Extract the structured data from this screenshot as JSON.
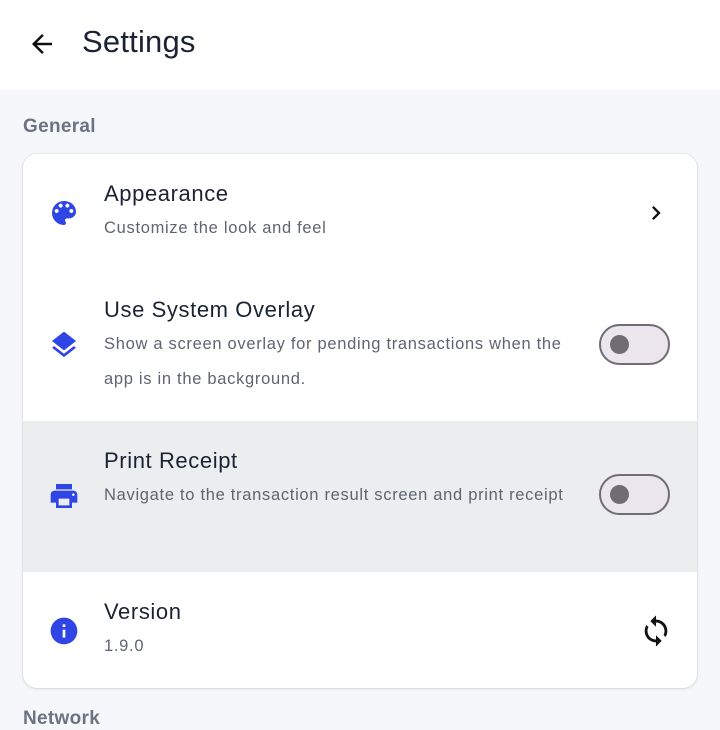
{
  "header": {
    "title": "Settings",
    "back_icon": "arrow-back-icon"
  },
  "sections": [
    {
      "title": "General",
      "items": [
        {
          "title": "Appearance",
          "subtitle": "Customize the look and feel",
          "icon": "palette-icon",
          "trailing": "chevron-right-icon"
        },
        {
          "title": "Use System Overlay",
          "subtitle": "Show a screen overlay for pending transactions when the app is in the background.",
          "icon": "layers-icon",
          "toggle_on": false
        },
        {
          "title": "Print Receipt",
          "subtitle": "Navigate to the transaction result screen and print receipt",
          "icon": "printer-icon",
          "toggle_on": false
        },
        {
          "title": "Version",
          "subtitle": "1.9.0",
          "icon": "info-icon",
          "trailing": "sync-icon"
        }
      ]
    }
  ],
  "next_section": {
    "title": "Network"
  },
  "colors": {
    "accent": "#2f45e6",
    "background": "#f6f7fb",
    "card": "#ffffff",
    "highlight": "#ebedef"
  }
}
